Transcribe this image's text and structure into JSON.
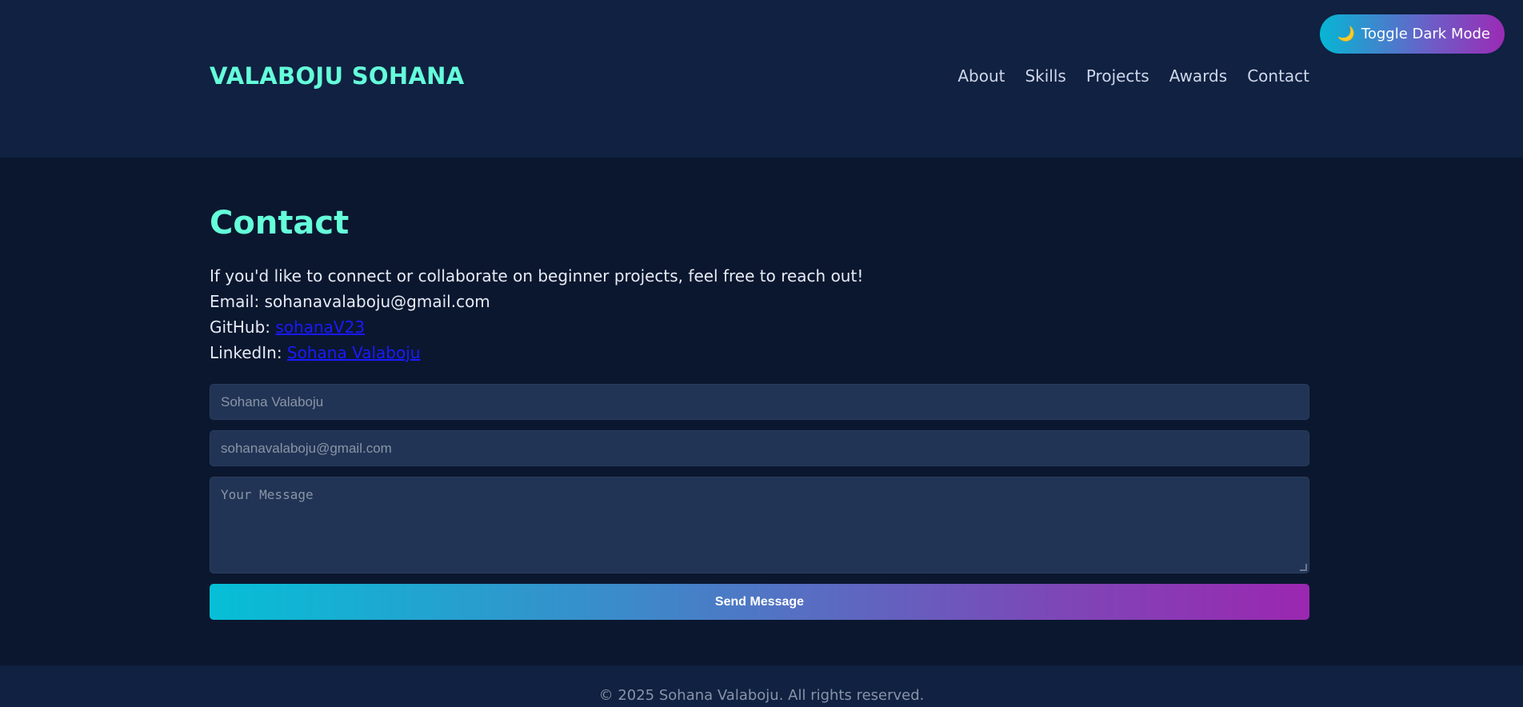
{
  "toggle": {
    "icon": "🌙",
    "label": "Toggle Dark Mode"
  },
  "header": {
    "logo": "VALABOJU SOHANA",
    "nav": [
      "About",
      "Skills",
      "Projects",
      "Awards",
      "Contact"
    ]
  },
  "contact": {
    "title": "Contact",
    "intro": "If you'd like to connect or collaborate on beginner projects, feel free to reach out!",
    "email_line": "Email: sohanavalaboju@gmail.com",
    "github_label": "GitHub: ",
    "github_link": "sohanaV23",
    "linkedin_label": "LinkedIn: ",
    "linkedin_link": "Sohana Valaboju"
  },
  "form": {
    "name_placeholder": "Sohana Valaboju",
    "email_placeholder": "sohanavalaboju@gmail.com",
    "message_placeholder": "Your Message",
    "submit_label": "Send Message"
  },
  "footer": {
    "text": "© 2025 Sohana Valaboju. All rights reserved."
  },
  "colors": {
    "accent": "#64ffda",
    "header_bg": "#102141",
    "page_bg": "#0b172f",
    "input_bg": "#213455",
    "gradient_start": "#06b6d4",
    "gradient_end": "#9b27b0"
  }
}
